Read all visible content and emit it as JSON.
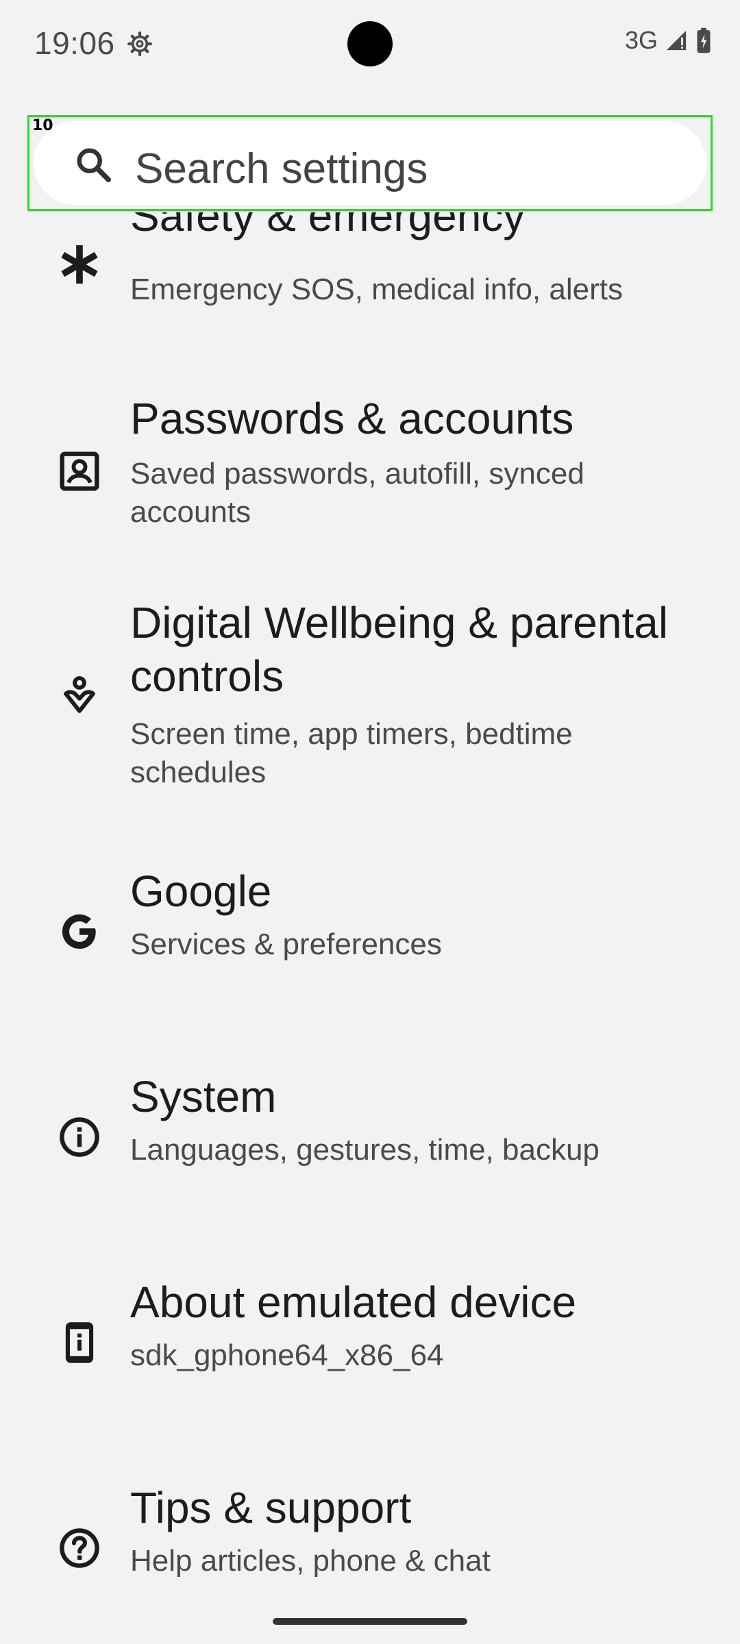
{
  "status_bar": {
    "time": "19:06",
    "network": "3G",
    "icons": [
      "settings-gear-icon",
      "signal-icon",
      "battery-icon"
    ]
  },
  "search": {
    "index_label": "10",
    "placeholder": "Search settings",
    "icon": "search-icon"
  },
  "items": [
    {
      "title": "Safety & emergency",
      "subtitle": "Emergency SOS, medical info, alerts",
      "icon": "asterisk-icon"
    },
    {
      "title": "Passwords & accounts",
      "subtitle": "Saved passwords, autofill, synced accounts",
      "icon": "account-box-icon"
    },
    {
      "title": "Digital Wellbeing & parental controls",
      "subtitle": "Screen time, app timers, bedtime schedules",
      "icon": "wellbeing-icon"
    },
    {
      "title": "Google",
      "subtitle": "Services & preferences",
      "icon": "google-g-icon"
    },
    {
      "title": "System",
      "subtitle": "Languages, gestures, time, backup",
      "icon": "info-icon"
    },
    {
      "title": "About emulated device",
      "subtitle": "sdk_gphone64_x86_64",
      "icon": "device-info-icon"
    },
    {
      "title": "Tips & support",
      "subtitle": "Help articles, phone & chat",
      "icon": "help-icon"
    }
  ],
  "colors": {
    "background": "#f2f2f2",
    "search_bg": "#ffffff",
    "highlight_border": "#2bdc2b",
    "title_text": "#1c1c1c",
    "subtitle_text": "#4a4a4a"
  }
}
